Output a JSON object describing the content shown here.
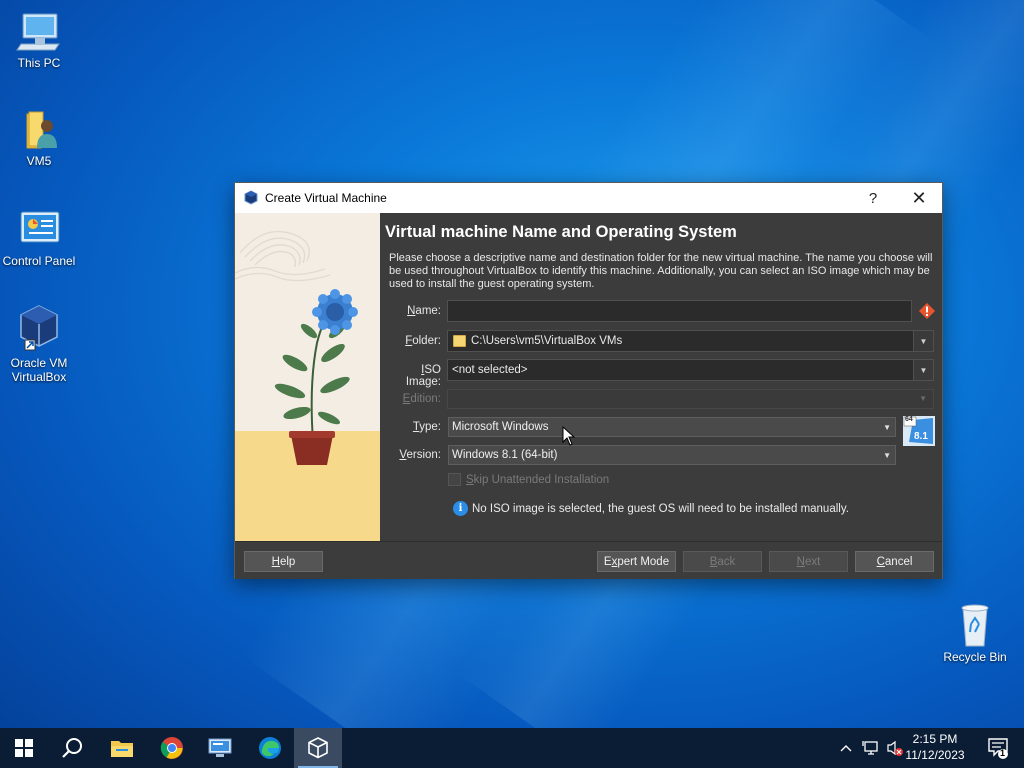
{
  "desktop": {
    "icons": [
      {
        "label": "This PC"
      },
      {
        "label": "VM5"
      },
      {
        "label": "Control Panel"
      },
      {
        "label_line1": "Oracle VM",
        "label_line2": "VirtualBox"
      },
      {
        "label": "Recycle Bin"
      }
    ]
  },
  "dialog": {
    "title": "Create Virtual Machine",
    "help_glyph": "?",
    "close_glyph": "✕",
    "heading": "Virtual machine Name and Operating System",
    "description": "Please choose a descriptive name and destination folder for the new virtual machine. The name you choose will be used throughout VirtualBox to identify this machine. Additionally, you can select an ISO image which may be used to install the guest operating system.",
    "fields": {
      "name": {
        "label_u": "N",
        "label_rest": "ame:",
        "value": ""
      },
      "folder": {
        "label_u": "F",
        "label_rest": "older:",
        "value": "C:\\Users\\vm5\\VirtualBox VMs"
      },
      "iso": {
        "label_u": "I",
        "label_rest": "SO Image:",
        "value": "<not selected>"
      },
      "edition": {
        "label_u": "E",
        "label_rest": "dition:",
        "value": ""
      },
      "type": {
        "label_u": "T",
        "label_rest": "ype:",
        "value": "Microsoft Windows"
      },
      "version": {
        "label_u": "V",
        "label_rest": "ersion:",
        "value": "Windows 8.1 (64-bit)"
      }
    },
    "os_badge": {
      "top": "64",
      "bottom": "8.1"
    },
    "skip_unattended": {
      "label_u": "S",
      "label_rest": "kip Unattended Installation",
      "checked": false
    },
    "info_message": "No ISO image is selected, the guest OS will need to be installed manually.",
    "buttons": {
      "help": {
        "u": "H",
        "rest": "elp"
      },
      "expert": {
        "pre": "E",
        "u": "x",
        "rest": "pert Mode"
      },
      "back": {
        "u": "B",
        "rest": "ack"
      },
      "next": {
        "u": "N",
        "rest": "ext"
      },
      "cancel": {
        "u": "C",
        "rest": "ancel"
      }
    }
  },
  "taskbar": {
    "clock_time": "2:15 PM",
    "clock_date": "11/12/2023",
    "notification_count": "1"
  },
  "colors": {
    "accent": "#0a78d8",
    "dialog_bg": "#3c3c3c",
    "taskbar": "#0b1d34"
  }
}
